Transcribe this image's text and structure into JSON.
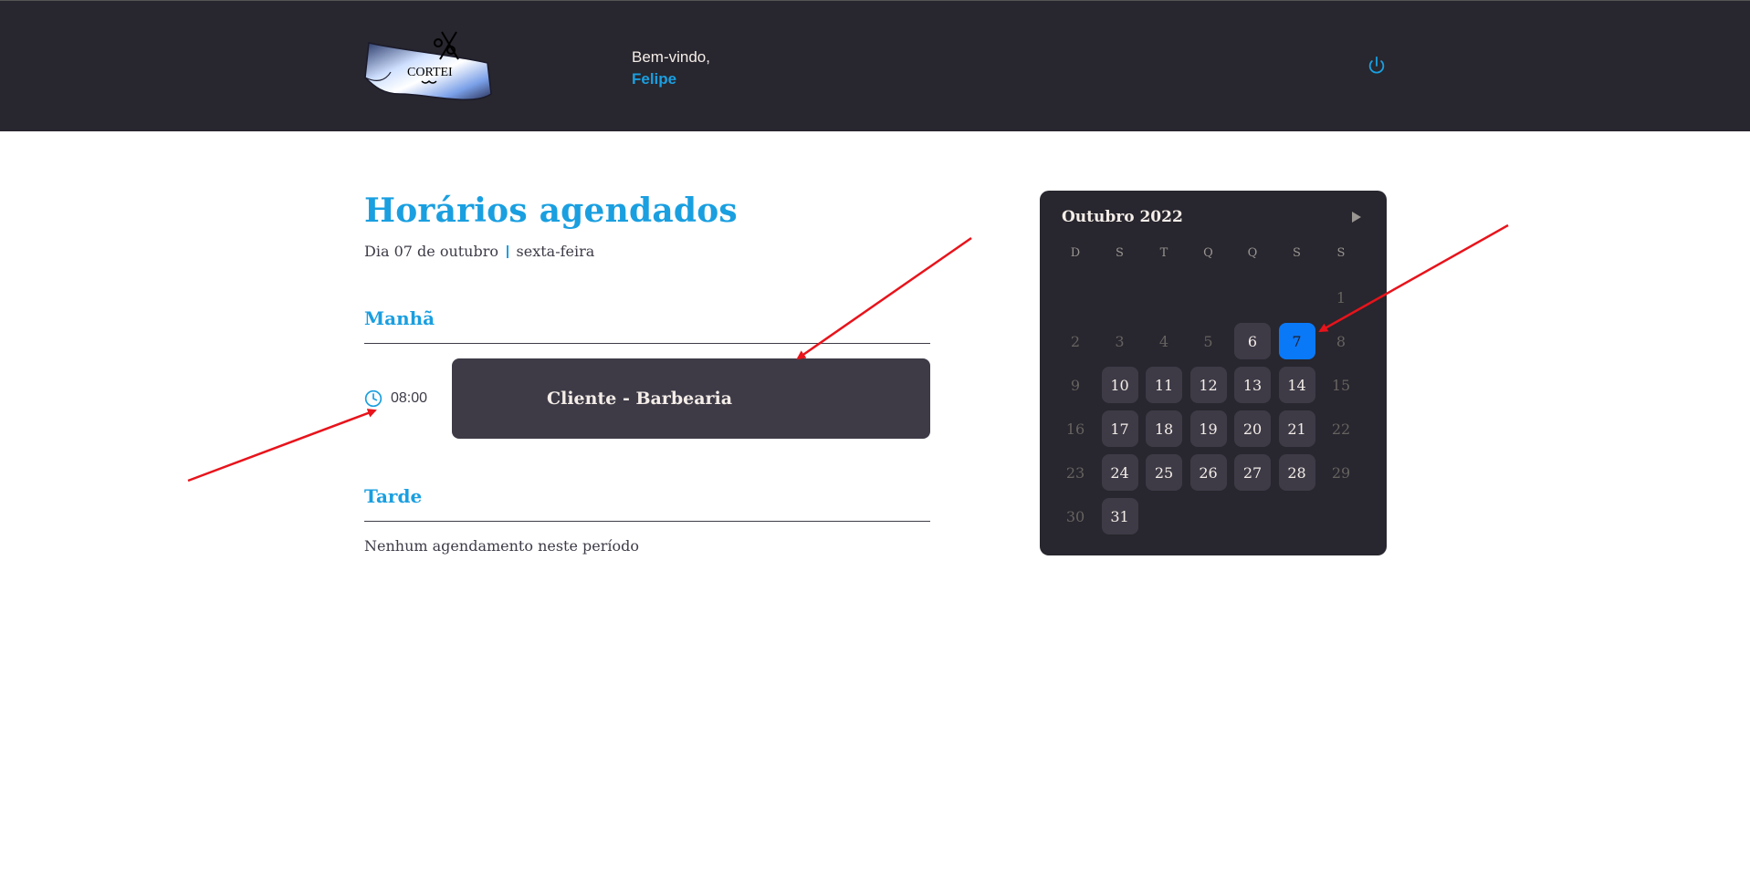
{
  "header": {
    "logo_text": "CORTEI",
    "greeting": "Bem-vindo,",
    "user_name": "Felipe",
    "logout_icon": "power-icon"
  },
  "schedule": {
    "title": "Horários agendados",
    "date_label": "Dia 07 de outubro",
    "weekday_label": "sexta-feira",
    "morning": {
      "title": "Manhã",
      "appointments": [
        {
          "time": "08:00",
          "client": "Cliente - Barbearia",
          "time_icon": "clock-icon"
        }
      ]
    },
    "afternoon": {
      "title": "Tarde",
      "empty_message": "Nenhum agendamento neste período"
    }
  },
  "calendar": {
    "caption": "Outubro 2022",
    "next_icon": "play-icon",
    "weekdays": [
      "D",
      "S",
      "T",
      "Q",
      "Q",
      "S",
      "S"
    ],
    "first_weekday_index": 6,
    "days_in_month": 31,
    "selected_day": 7,
    "available_days": [
      6,
      7,
      10,
      11,
      12,
      13,
      14,
      17,
      18,
      19,
      20,
      21,
      24,
      25,
      26,
      27,
      28,
      31
    ]
  },
  "colors": {
    "accent": "#1a9fe0",
    "selected": "#0a79f8",
    "header_bg": "#28262e",
    "card_bg": "#3e3b47",
    "annotation_arrow": "#e8131b"
  }
}
